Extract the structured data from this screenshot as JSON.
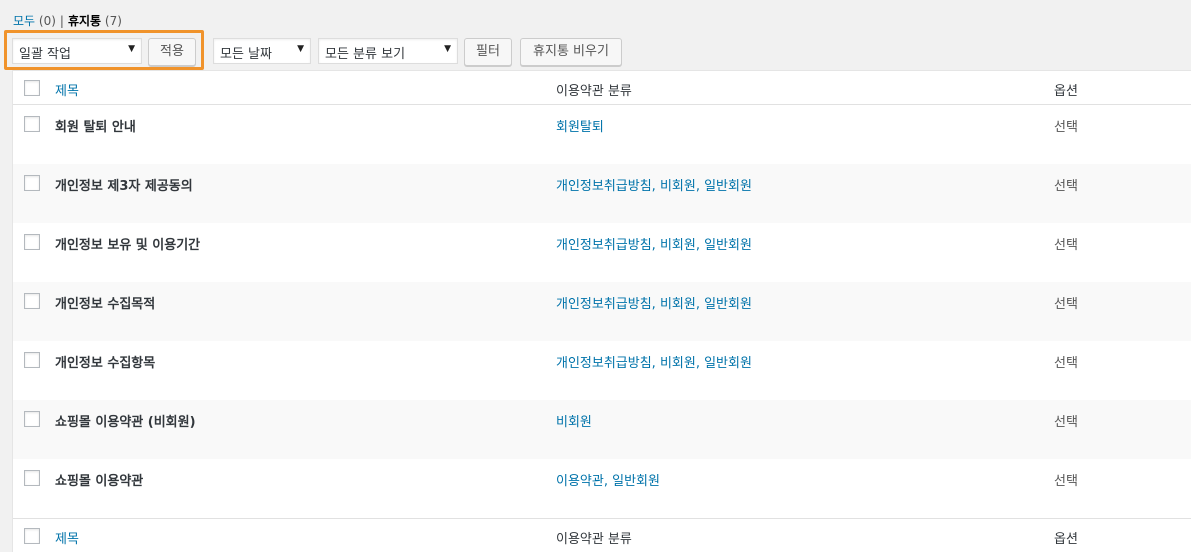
{
  "filters": {
    "all_label": "모두",
    "all_count": "(0)",
    "separator": "|",
    "trash_label": "휴지통",
    "trash_count": "(7)"
  },
  "toolbar": {
    "bulk_action": "일괄 작업",
    "apply": "적용",
    "date_filter": "모든 날짜",
    "category_filter": "모든 분류 보기",
    "filter": "필터",
    "empty_trash": "휴지통 비우기"
  },
  "columns": {
    "title": "제목",
    "category": "이용약관 분류",
    "option": "옵션"
  },
  "rows": [
    {
      "title": "회원 탈퇴 안내",
      "category": "회원탈퇴",
      "option": "선택"
    },
    {
      "title": "개인정보 제3자 제공동의",
      "category": "개인정보취급방침, 비회원, 일반회원",
      "option": "선택"
    },
    {
      "title": "개인정보 보유 및 이용기간",
      "category": "개인정보취급방침, 비회원, 일반회원",
      "option": "선택"
    },
    {
      "title": "개인정보 수집목적",
      "category": "개인정보취급방침, 비회원, 일반회원",
      "option": "선택"
    },
    {
      "title": "개인정보 수집항목",
      "category": "개인정보취급방침, 비회원, 일반회원",
      "option": "선택"
    },
    {
      "title": "쇼핑몰 이용약관 (비회원)",
      "category": "비회원",
      "option": "선택"
    },
    {
      "title": "쇼핑몰 이용약관",
      "category": "이용약관, 일반회원",
      "option": "선택"
    }
  ],
  "colors": {
    "link": "#0073aa",
    "highlight": "#f0932b"
  }
}
